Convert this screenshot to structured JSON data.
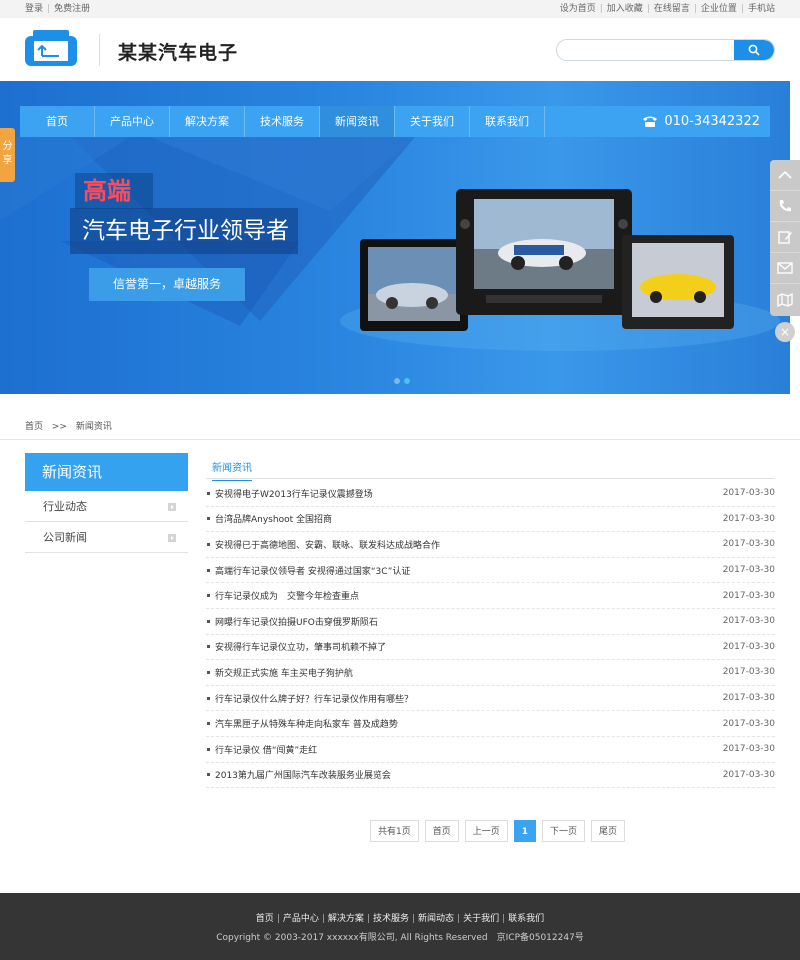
{
  "topbar": {
    "left": [
      "登录",
      "免费注册"
    ],
    "right": [
      "设为首页",
      "加入收藏",
      "在线留言",
      "企业位置",
      "手机站"
    ]
  },
  "header": {
    "company_name": "某某汽车电子",
    "search_placeholder": ""
  },
  "nav": {
    "items": [
      "首页",
      "产品中心",
      "解决方案",
      "技术服务",
      "新闻资讯",
      "关于我们",
      "联系我们"
    ],
    "active_index": 4,
    "phone": "010-34342322"
  },
  "banner": {
    "tag": "高端",
    "slogan": "汽车电子行业领导者",
    "sub": "信誉第一，卓越服务"
  },
  "share_label": "分享",
  "breadcrumb": {
    "home": "首页",
    "sep": ">>",
    "current": "新闻资讯"
  },
  "sidebar": {
    "title": "新闻资讯",
    "items": [
      "行业动态",
      "公司新闻"
    ]
  },
  "main": {
    "tab": "新闻资讯",
    "news": [
      {
        "title": "安视得电子W2013行车记录仪震撼登场",
        "date": "2017-03-30"
      },
      {
        "title": "台湾品牌Anyshoot 全国招商",
        "date": "2017-03-30"
      },
      {
        "title": "安视得已于高德地图、安霸、联咏、联发科达成战略合作",
        "date": "2017-03-30"
      },
      {
        "title": "高端行车记录仪领导者 安视得通过国家“3C”认证",
        "date": "2017-03-30"
      },
      {
        "title": "行车记录仪成为　交警今年检查重点",
        "date": "2017-03-30"
      },
      {
        "title": "网曝行车记录仪拍摄UFO击穿俄罗斯陨石",
        "date": "2017-03-30"
      },
      {
        "title": "安视得行车记录仪立功，肇事司机赖不掉了",
        "date": "2017-03-30"
      },
      {
        "title": "新交规正式实施 车主买电子狗护航",
        "date": "2017-03-30"
      },
      {
        "title": "行车记录仪什么牌子好？行车记录仪作用有哪些？",
        "date": "2017-03-30"
      },
      {
        "title": "汽车黑匣子从特殊车种走向私家车 普及成趋势",
        "date": "2017-03-30"
      },
      {
        "title": "行车记录仪 借“闯黄”走红",
        "date": "2017-03-30"
      },
      {
        "title": "2013第九届广州国际汽车改装服务业展览会",
        "date": "2017-03-30"
      }
    ]
  },
  "pager": {
    "total": "共有1页",
    "first": "首页",
    "prev": "上一页",
    "current": "1",
    "next": "下一页",
    "last": "尾页"
  },
  "footer": {
    "links": [
      "首页",
      "产品中心",
      "解决方案",
      "技术服务",
      "新闻动态",
      "关于我们",
      "联系我们"
    ],
    "copyright": "Copyright © 2003-2017 xxxxxx有限公司, All Rights Reserved　京ICP备05012247号"
  },
  "colors": {
    "accent": "#1e8fe6",
    "nav": "#3ba3f1",
    "footer": "#353535",
    "share": "#f0a540"
  }
}
